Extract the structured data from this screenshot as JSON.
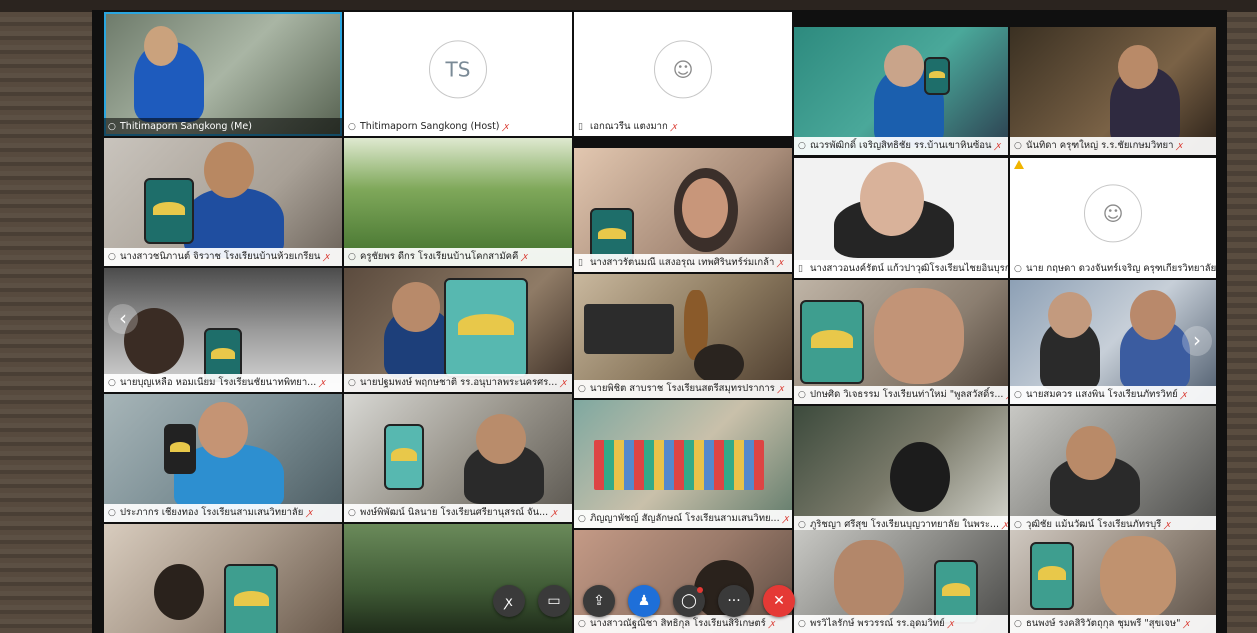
{
  "meeting": {
    "participants_row1": [
      {
        "name": "Thitimaporn Sangkong (Me)",
        "muted": false,
        "video": true
      },
      {
        "name": "Thitimaporn Sangkong (Host)",
        "muted": true,
        "video": false,
        "initials": "TS"
      },
      {
        "name": "เอกณวรีน แตงมาก",
        "muted": true,
        "video": false
      },
      {
        "name": "ณวรพัฒิกดิ์ เจริญสิทธิชัย รร.บ้านเขาหินซ้อน",
        "muted": true,
        "video": true
      },
      {
        "name": "นันทิดา ครุฑใหญ่ ร.ร.ชัยเกษมวิทยา",
        "muted": true,
        "video": true
      }
    ],
    "participants_row2": [
      {
        "name": "นางสาวชนิภานต์ จิรวาช โรงเรียนบ้านห้วยเกรียน",
        "muted": true,
        "video": true
      },
      {
        "name": "ครูชัยพร ดีกร โรงเรียนบ้านโคกสามัคคี",
        "muted": true,
        "video": true
      },
      {
        "name": "นางสาวรัตนมณี แสงอรุณ เทพศิรินทร์ร่มเกล้า",
        "muted": true,
        "video": true
      },
      {
        "name": "นางสาวอนงค์รัตน์ แก้วปาวุฒิโรงเรียนไชยอินบุรกะ",
        "muted": true,
        "video": true
      },
      {
        "name": "นาย กฤษดา ดวงจันทร์เจริญ ครุฑเกียรวิทยาลัยศรี...",
        "muted": true,
        "video": false
      }
    ],
    "participants_row3": [
      {
        "name": "นายบุญเหลือ หอมเนียม โรงเรียนชัยนาทพิทยา...",
        "muted": true,
        "video": true
      },
      {
        "name": "นายปฐมพงษ์ พฤกษชาติ รร.อนุบาลพระนครศร...",
        "muted": true,
        "video": true
      },
      {
        "name": "นายพิชิต สาบราช โรงเรียนสตรีสมุทรปราการ",
        "muted": true,
        "video": true
      },
      {
        "name": "ปกษศิด วิเจธรรม โรงเรียนท่าใหม่ \"พูลสวัสดิ์ร...",
        "muted": true,
        "video": true
      },
      {
        "name": "นายสมควร แสงพิน โรงเรียนภัทรวิทย์",
        "muted": true,
        "video": true
      }
    ],
    "participants_row4": [
      {
        "name": "ประภากร เชียงทอง โรงเรียนสามเสนวิทยาลัย",
        "muted": true,
        "video": true
      },
      {
        "name": "พงษ์พิพัฒน์ นิลนาย โรงเรียนศรียานุสรณ์ จัน...",
        "muted": true,
        "video": true
      },
      {
        "name": "ภิญญาพัชญ์ สัญลักษณ์ โรงเรียนสามเสนวิทย...",
        "muted": true,
        "video": true
      },
      {
        "name": "ภูริชญา ศรีสุข โรงเรียนบุญวาทยาลัย ในพระ...",
        "muted": true,
        "video": true
      },
      {
        "name": "วุฒิชัย แม้นวัฒน์ โรงเรียนภัทรบุรี",
        "muted": true,
        "video": true
      }
    ],
    "participants_row5": [
      {
        "name": "",
        "muted": false,
        "video": true
      },
      {
        "name": "",
        "muted": false,
        "video": true
      },
      {
        "name": "นางสาวณัฐณิชา สิทธิกุล โรงเรียนสิริเกษตร์",
        "muted": true,
        "video": true
      },
      {
        "name": "พรวิไลรักษ์ พรวรรณ์ รร.อุดมวิทย์",
        "muted": true,
        "video": true
      },
      {
        "name": "ธนพงษ์ รงคสิริวัตถุกุล ชุมพรี \"สุขเจษ\"",
        "muted": true,
        "video": true
      }
    ]
  },
  "icons": {
    "mic": "○",
    "muted_mic": "ꭗ",
    "phone": "▯",
    "prev": "‹",
    "next": "›"
  },
  "toolbar": {
    "mute": "ꭗ",
    "video": "▭",
    "share": "⇪",
    "participants": "♟",
    "chat": "◯",
    "more": "···",
    "leave": "✕"
  },
  "colors": {
    "accent": "#1e6fd9",
    "leave": "#e53935",
    "selected": "#2aa6e0"
  }
}
